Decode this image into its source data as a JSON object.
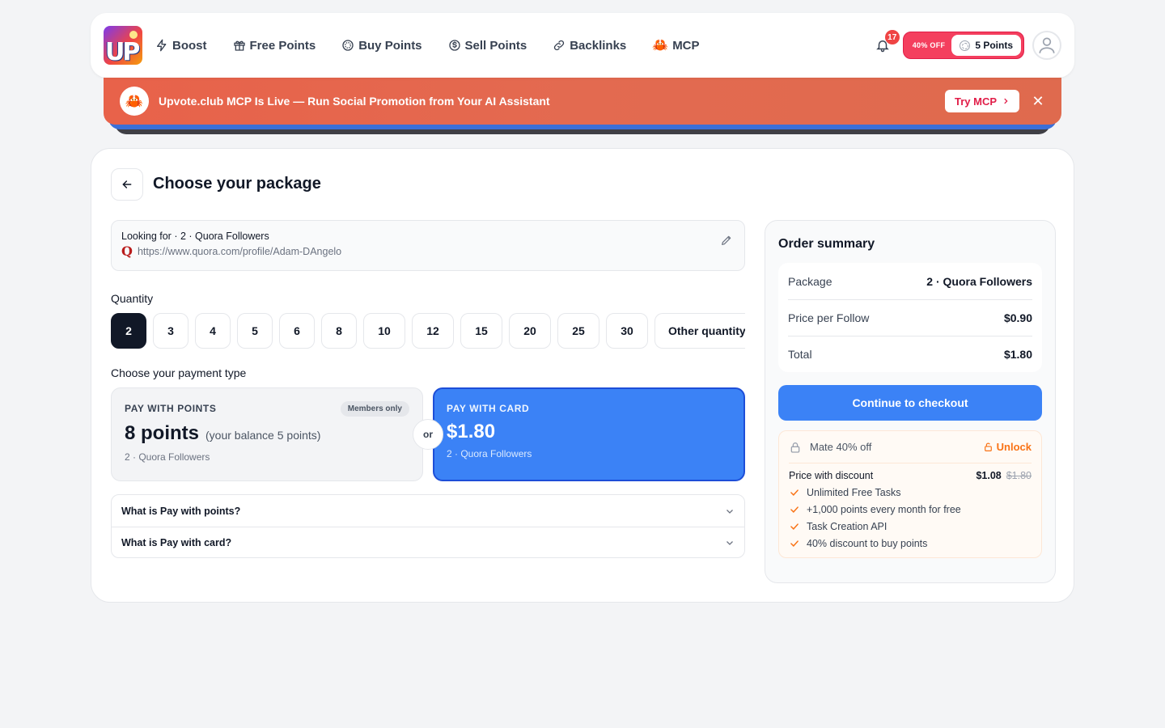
{
  "header": {
    "nav": [
      {
        "label": "Boost",
        "icon": "bolt-icon"
      },
      {
        "label": "Free Points",
        "icon": "gift-icon"
      },
      {
        "label": "Buy Points",
        "icon": "coin-icon"
      },
      {
        "label": "Sell Points",
        "icon": "dollar-icon"
      },
      {
        "label": "Backlinks",
        "icon": "link-icon"
      },
      {
        "label": "MCP",
        "icon": "crab-icon"
      }
    ],
    "notification_count": "17",
    "discount_label": "40% OFF",
    "points_label": "5 Points"
  },
  "banner": {
    "text": "Upvote.club MCP Is Live — Run Social Promotion from Your AI Assistant",
    "button": "Try MCP",
    "close": "✕"
  },
  "page": {
    "title": "Choose your package",
    "looking_for": "Looking for · 2 · Quora Followers",
    "url": "https://www.quora.com/profile/Adam-DAngelo",
    "quantity_label": "Quantity",
    "quantities": [
      "2",
      "3",
      "4",
      "5",
      "6",
      "8",
      "10",
      "12",
      "15",
      "20",
      "25",
      "30"
    ],
    "selected_quantity": "2",
    "other_quantity": "Other quantity",
    "payment_label": "Choose your payment type",
    "pay_points": {
      "head": "PAY WITH POINTS",
      "badge": "Members only",
      "amount": "8 points",
      "balance": "(your balance 5 points)",
      "sub": "2 · Quora Followers"
    },
    "or": "or",
    "pay_card": {
      "head": "PAY WITH CARD",
      "price": "$1.80",
      "sub": "2 · Quora Followers"
    },
    "faq": [
      "What is Pay with points?",
      "What is Pay with card?"
    ]
  },
  "summary": {
    "title": "Order summary",
    "rows": [
      {
        "k": "Package",
        "v": "2 · Quora Followers"
      },
      {
        "k": "Price per Follow",
        "v": "$0.90"
      },
      {
        "k": "Total",
        "v": "$1.80"
      }
    ],
    "checkout": "Continue to checkout",
    "mate": {
      "label": "Mate 40% off",
      "unlock": "Unlock",
      "discount_label": "Price with discount",
      "discount_price": "$1.08",
      "original_price": "$1.80",
      "features": [
        "Unlimited Free Tasks",
        "+1,000 points every month for free",
        "Task Creation API",
        "40% discount to buy points"
      ]
    }
  },
  "colors": {
    "primary": "#3b82f6",
    "banner": "#e36a50",
    "accent_pink": "#f43f5e",
    "orange": "#f97316"
  }
}
